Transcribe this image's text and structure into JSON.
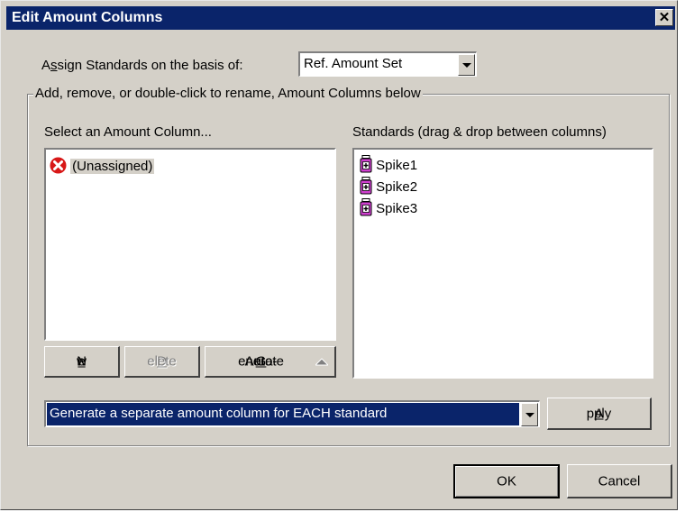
{
  "dialog": {
    "title": "Edit Amount Columns",
    "close_symbol": "✕"
  },
  "assign": {
    "label_prefix": "A",
    "label_underlined": "s",
    "label_suffix": "sign Standards on the basis of:",
    "selected": "Ref. Amount Set"
  },
  "group": {
    "label": "Add, remove, or double-click to rename, Amount Columns below"
  },
  "amount_columns": {
    "label": "Select an Amount Column...",
    "items": [
      {
        "label": "(Unassigned)",
        "icon": "error-x-icon",
        "selected": true
      }
    ]
  },
  "standards": {
    "label": "Standards (drag & drop between columns)",
    "items": [
      {
        "label": "Spike1",
        "icon": "vial-icon"
      },
      {
        "label": "Spike2",
        "icon": "vial-icon"
      },
      {
        "label": "Spike3",
        "icon": "vial-icon"
      }
    ]
  },
  "buttons": {
    "new_prefix": "N",
    "new_underlined": "e",
    "new_suffix": "w",
    "delete_prefix": "",
    "delete_underlined": "D",
    "delete_suffix": "elete",
    "auto_prefix": "Auto-",
    "auto_underlined": "G",
    "auto_suffix": "enerate",
    "apply_prefix": "",
    "apply_underlined": "A",
    "apply_suffix": "pply",
    "ok": "OK",
    "cancel": "Cancel"
  },
  "generate_mode": {
    "selected": "Generate a separate amount column for EACH standard"
  },
  "colors": {
    "title_bar": "#0a246a",
    "dialog_face": "#d4d0c8",
    "selection": "#0a246a",
    "error_icon": "#d81818",
    "vial_icon": "#d040d0"
  }
}
